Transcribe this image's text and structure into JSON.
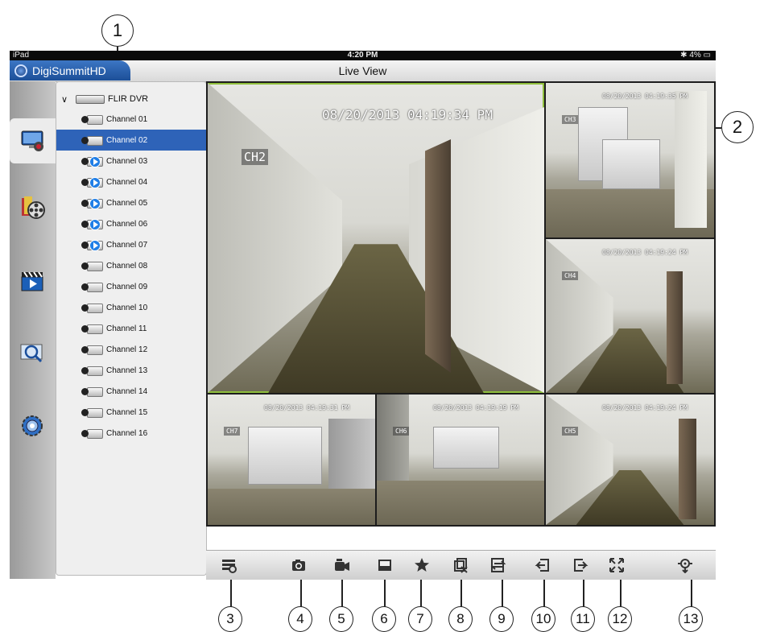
{
  "status_bar": {
    "carrier": "iPad",
    "time": "4:20 PM",
    "battery": "4%"
  },
  "app": {
    "name": "DigiSummitHD",
    "title": "Live View"
  },
  "rail": [
    {
      "icon": "live-view-monitor-icon",
      "active": true
    },
    {
      "icon": "playback-film-reel-icon",
      "active": false
    },
    {
      "icon": "video-clapper-icon",
      "active": false
    },
    {
      "icon": "search-image-icon",
      "active": false
    },
    {
      "icon": "settings-gear-icon",
      "active": false
    }
  ],
  "tree": {
    "device": "FLIR DVR",
    "channels": [
      {
        "label": "Channel 01",
        "playing": false,
        "selected": false
      },
      {
        "label": "Channel 02",
        "playing": true,
        "selected": true
      },
      {
        "label": "Channel 03",
        "playing": true,
        "selected": false
      },
      {
        "label": "Channel 04",
        "playing": true,
        "selected": false
      },
      {
        "label": "Channel 05",
        "playing": true,
        "selected": false
      },
      {
        "label": "Channel 06",
        "playing": true,
        "selected": false
      },
      {
        "label": "Channel 07",
        "playing": true,
        "selected": false
      },
      {
        "label": "Channel 08",
        "playing": false,
        "selected": false
      },
      {
        "label": "Channel 09",
        "playing": false,
        "selected": false
      },
      {
        "label": "Channel 10",
        "playing": false,
        "selected": false
      },
      {
        "label": "Channel 11",
        "playing": false,
        "selected": false
      },
      {
        "label": "Channel 12",
        "playing": false,
        "selected": false
      },
      {
        "label": "Channel 13",
        "playing": false,
        "selected": false
      },
      {
        "label": "Channel 14",
        "playing": false,
        "selected": false
      },
      {
        "label": "Channel 15",
        "playing": false,
        "selected": false
      },
      {
        "label": "Channel 16",
        "playing": false,
        "selected": false
      }
    ]
  },
  "feeds": {
    "main": {
      "timestamp": "08/20/2013 04:19:34 PM",
      "channel": "CH2"
    },
    "f3": {
      "timestamp": "08/20/2013 04:19:35 PM",
      "channel": "CH3"
    },
    "f4": {
      "timestamp": "08/20/2013 04:19:24 PM",
      "channel": "CH4"
    },
    "f7": {
      "timestamp": "08/20/2013 04:19:31 PM",
      "channel": "CH7"
    },
    "f6": {
      "timestamp": "08/20/2013 04:19:19 PM",
      "channel": "CH6"
    },
    "f5": {
      "timestamp": "08/20/2013 04:19:24 PM",
      "channel": "CH5"
    }
  },
  "toolbar": [
    "layout-menu-icon",
    "snapshot-camera-icon",
    "record-video-icon",
    "split-screen-icon",
    "favorite-star-icon",
    "close-all-icon",
    "swap-stream-icon",
    "previous-page-icon",
    "next-page-icon",
    "fullscreen-icon",
    "ptz-control-icon"
  ],
  "callouts": [
    "1",
    "2",
    "3",
    "4",
    "5",
    "6",
    "7",
    "8",
    "9",
    "10",
    "11",
    "12",
    "13"
  ],
  "colors": {
    "accent": "#2e63b8",
    "selection_border": "#8fbf3c"
  }
}
